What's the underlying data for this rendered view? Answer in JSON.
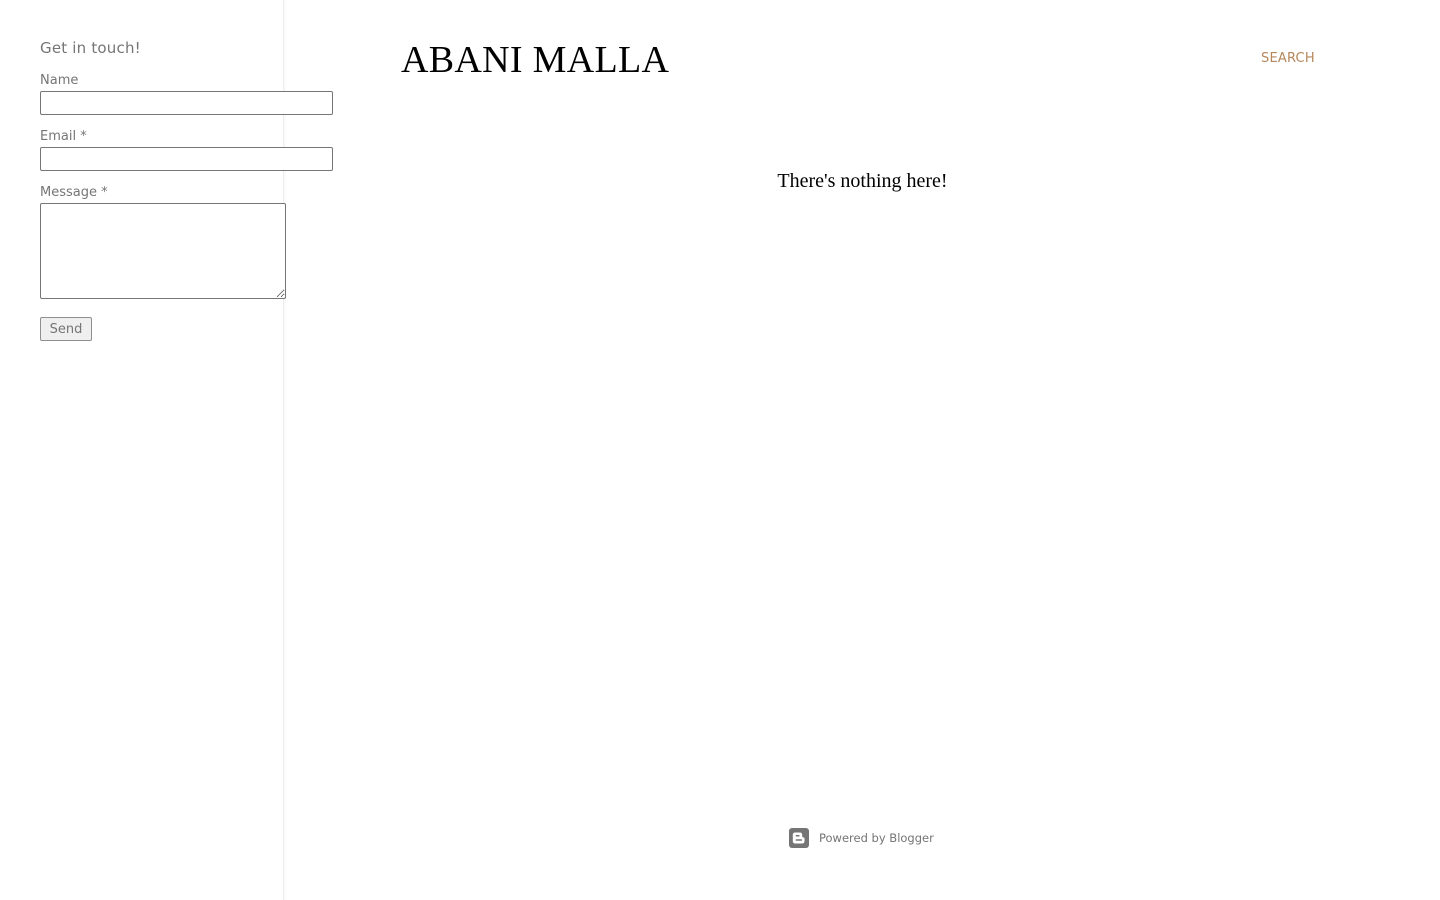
{
  "sidebar": {
    "contact_title": "Get in touch!",
    "name_label": "Name",
    "email_label": "Email *",
    "message_label": "Message *",
    "name_value": "",
    "email_value": "",
    "message_value": "",
    "send_label": "Send"
  },
  "header": {
    "blog_title": "ABANI MALLA",
    "search_label": "SEARCH"
  },
  "main": {
    "empty_message": "There's nothing here!"
  },
  "footer": {
    "powered_by": "Powered by Blogger",
    "icon": "blogger-icon"
  },
  "colors": {
    "accent": "#b5875b",
    "text": "#757575",
    "title": "#000000"
  }
}
